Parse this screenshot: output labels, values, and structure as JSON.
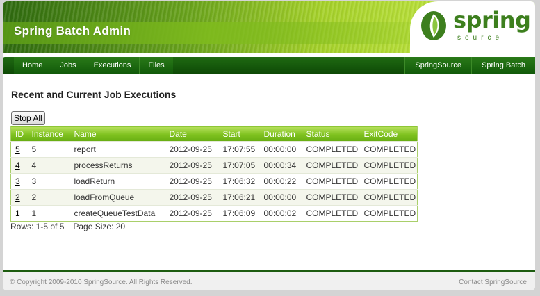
{
  "header": {
    "title": "Spring Batch Admin",
    "logo_word": "spring",
    "logo_sub": "source"
  },
  "nav": {
    "left": [
      {
        "label": "Home"
      },
      {
        "label": "Jobs"
      },
      {
        "label": "Executions"
      },
      {
        "label": "Files"
      }
    ],
    "right": [
      {
        "label": "SpringSource"
      },
      {
        "label": "Spring Batch"
      }
    ]
  },
  "main": {
    "title": "Recent and Current Job Executions",
    "stop_all_label": "Stop All",
    "table": {
      "columns": [
        "ID",
        "Instance",
        "Name",
        "Date",
        "Start",
        "Duration",
        "Status",
        "ExitCode"
      ],
      "rows": [
        {
          "id": "5",
          "instance": "5",
          "name": "report",
          "date": "2012-09-25",
          "start": "17:07:55",
          "duration": "00:00:00",
          "status": "COMPLETED",
          "exit_code": "COMPLETED"
        },
        {
          "id": "4",
          "instance": "4",
          "name": "processReturns",
          "date": "2012-09-25",
          "start": "17:07:05",
          "duration": "00:00:34",
          "status": "COMPLETED",
          "exit_code": "COMPLETED"
        },
        {
          "id": "3",
          "instance": "3",
          "name": "loadReturn",
          "date": "2012-09-25",
          "start": "17:06:32",
          "duration": "00:00:22",
          "status": "COMPLETED",
          "exit_code": "COMPLETED"
        },
        {
          "id": "2",
          "instance": "2",
          "name": "loadFromQueue",
          "date": "2012-09-25",
          "start": "17:06:21",
          "duration": "00:00:00",
          "status": "COMPLETED",
          "exit_code": "COMPLETED"
        },
        {
          "id": "1",
          "instance": "1",
          "name": "createQueueTestData",
          "date": "2012-09-25",
          "start": "17:06:09",
          "duration": "00:00:02",
          "status": "COMPLETED",
          "exit_code": "COMPLETED"
        }
      ]
    },
    "pager": {
      "rows_text": "Rows: 1-5 of 5",
      "page_size_text": "Page Size: 20"
    }
  },
  "footer": {
    "copyright": "© Copyright 2009-2010 SpringSource. All Rights Reserved.",
    "contact": "Contact SpringSource"
  },
  "colors": {
    "brand_green": "#3d7f1e",
    "nav_dark": "#0e4a06",
    "table_header": "#7fc21f"
  },
  "icons": [
    "springsource-leaf-logo"
  ]
}
